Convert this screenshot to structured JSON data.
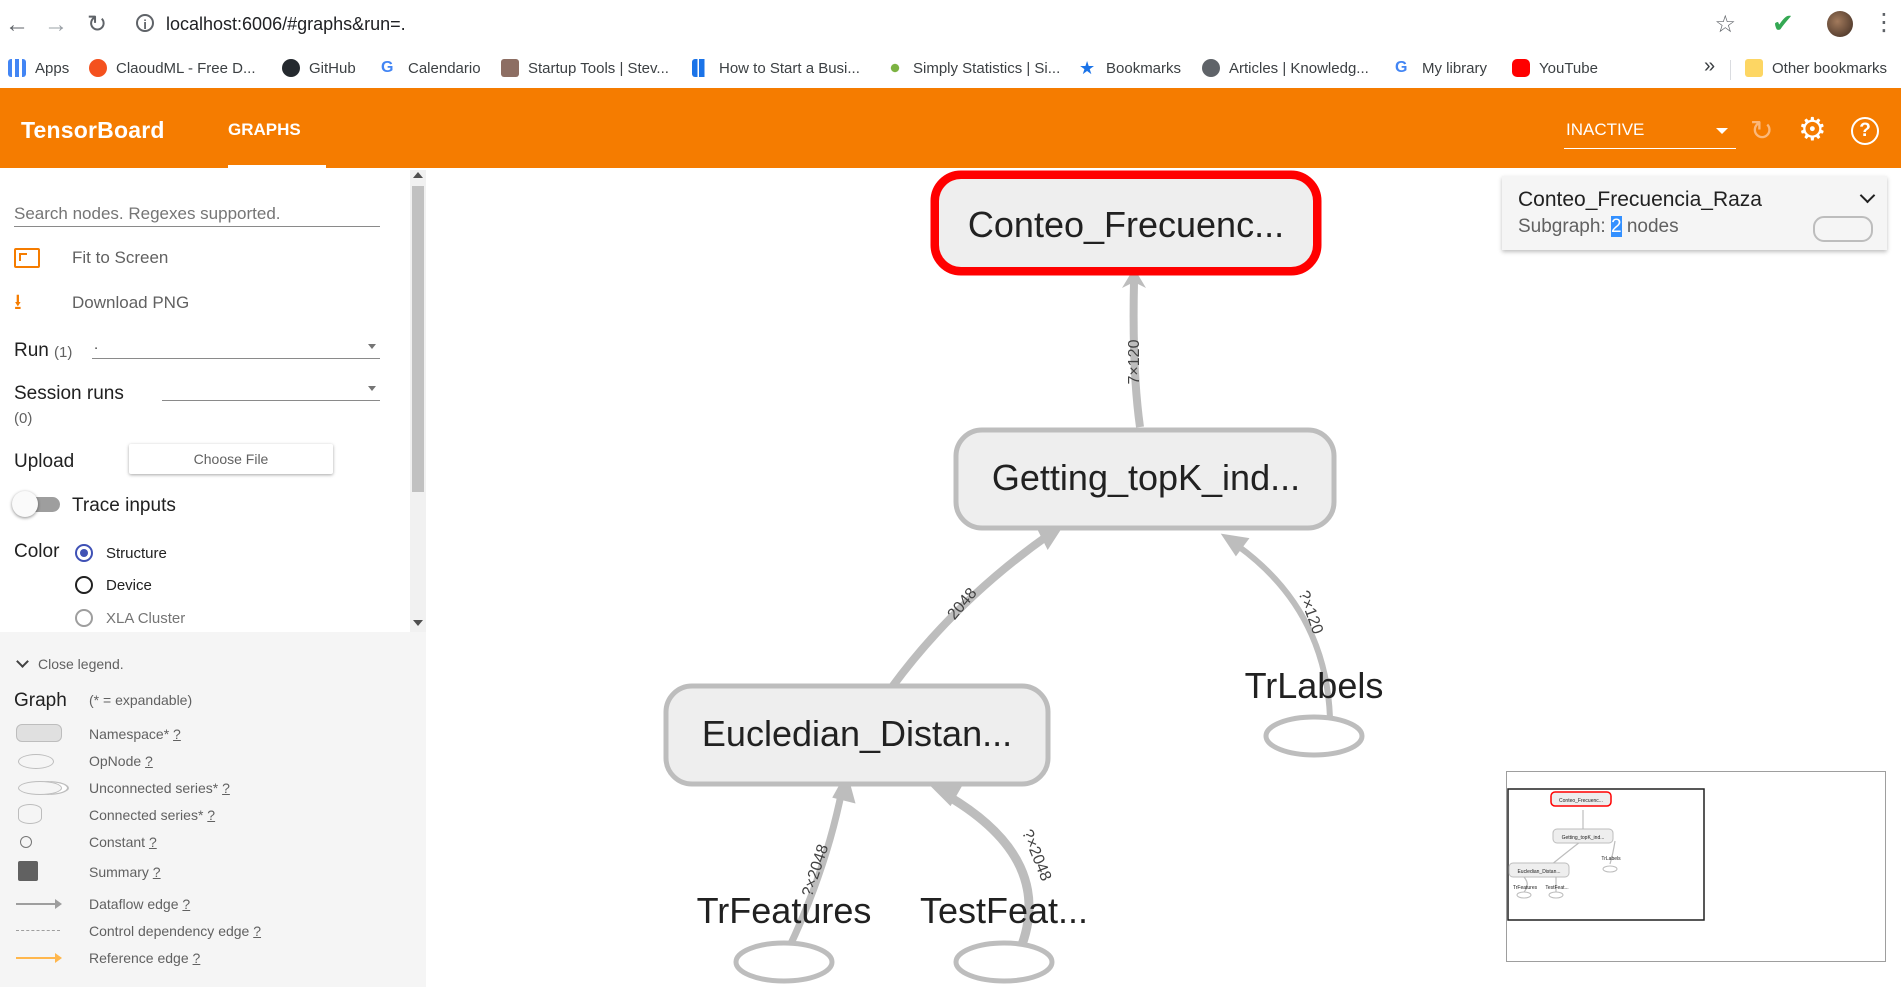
{
  "browser": {
    "url": "localhost:6006/#graphs&run=.",
    "bookmarks": [
      {
        "label": "Apps",
        "color": "#4285f4"
      },
      {
        "label": "ClaoudML - Free D...",
        "color": "#f4511e"
      },
      {
        "label": "GitHub",
        "color": "#24292e"
      },
      {
        "label": "Calendario",
        "color": "#4285f4"
      },
      {
        "label": "Startup Tools | Stev...",
        "color": "#8d6e63"
      },
      {
        "label": "How to Start a Busi...",
        "color": "#1a73e8"
      },
      {
        "label": "Simply Statistics | Si...",
        "color": "#7cb342"
      },
      {
        "label": "Bookmarks",
        "color": "#1a73e8"
      },
      {
        "label": "Articles | Knowledg...",
        "color": "#5f6368"
      },
      {
        "label": "My library",
        "color": "#4285f4"
      },
      {
        "label": "YouTube",
        "color": "#ff0000"
      }
    ],
    "more": "»",
    "other_bookmarks": "Other bookmarks"
  },
  "header": {
    "title": "TensorBoard",
    "tab": "GRAPHS",
    "run_status": "INACTIVE",
    "accent": "#f57c00"
  },
  "sidebar": {
    "search_placeholder": "Search nodes. Regexes supported.",
    "fit_to_screen": "Fit to Screen",
    "download_png": "Download PNG",
    "run_label": "Run",
    "run_count": "(1)",
    "run_value": ".",
    "session_runs_label": "Session runs",
    "session_runs_count": "(0)",
    "upload_label": "Upload",
    "choose_file": "Choose File",
    "trace_inputs": "Trace inputs",
    "color_label": "Color",
    "color_options": [
      "Structure",
      "Device",
      "XLA Cluster"
    ],
    "color_selected": "Structure"
  },
  "legend": {
    "toggle": "Close legend.",
    "title": "Graph",
    "note": "(* = expandable)",
    "items": [
      {
        "label": "Namespace*",
        "help": "?"
      },
      {
        "label": "OpNode",
        "help": "?"
      },
      {
        "label": "Unconnected series*",
        "help": "?"
      },
      {
        "label": "Connected series*",
        "help": "?"
      },
      {
        "label": "Constant",
        "help": "?"
      },
      {
        "label": "Summary",
        "help": "?"
      },
      {
        "label": "Dataflow edge",
        "help": "?"
      },
      {
        "label": "Control dependency edge",
        "help": "?"
      },
      {
        "label": "Reference edge",
        "help": "?"
      }
    ]
  },
  "graph": {
    "nodes": {
      "conteo": "Conteo_Frecuenc...",
      "getting": "Getting_topK_ind...",
      "eucledian": "Eucledian_Distan...",
      "trlabels": "TrLabels",
      "trfeatures": "TrFeatures",
      "testfeat": "TestFeat..."
    },
    "edges": {
      "getting_to_conteo": "7×120",
      "eucledian_to_getting": "2048",
      "trlabels_to_getting": "?×120",
      "trfeatures_to_eucledian": "?×2048",
      "testfeat_to_eucledian": "?×2048"
    },
    "selected_color": "#ff0000"
  },
  "info_card": {
    "title": "Conteo_Frecuencia_Raza",
    "subgraph_prefix": "Subgraph: ",
    "node_count": "2",
    "subgraph_suffix": " nodes"
  },
  "minimap": {
    "labels": [
      "Conteo_Frecuenc...",
      "Getting_topK_ind...",
      "Eucledian_Distan...",
      "TrLabels",
      "TrFeatures",
      "TestFeat..."
    ]
  }
}
